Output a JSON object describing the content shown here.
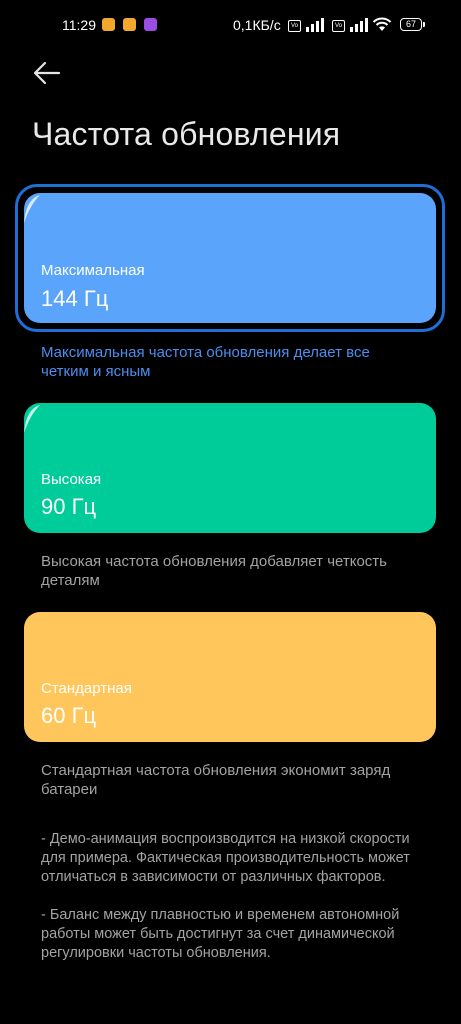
{
  "status_bar": {
    "time": "11:29",
    "net_speed": "0,1КБ/с",
    "volte_label": "Vo",
    "battery": "67"
  },
  "header": {
    "title": "Частота обновления"
  },
  "options": [
    {
      "label": "Максимальная",
      "value": "144 Гц",
      "description": "Максимальная частота обновления делает все четким и ясным",
      "selected": true,
      "color": "#5ba4fb"
    },
    {
      "label": "Высокая",
      "value": "90 Гц",
      "description": "Высокая частота обновления добавляет четкость деталям",
      "selected": false,
      "color": "#00cc99"
    },
    {
      "label": "Стандартная",
      "value": "60 Гц",
      "description": "Стандартная частота обновления экономит заряд батареи",
      "selected": false,
      "color": "#ffc65c"
    }
  ],
  "notes": [
    "- Демо-анимация воспроизводится на низкой скорости для примера. Фактическая производительность может отличаться в зависимости от различных факторов.",
    "- Баланс между плавностью и временем автономной работы может быть достигнут за счет динамической регулировки частоты обновления."
  ],
  "colors": {
    "accent": "#1d6fd6",
    "accent_text": "#4a8ef0",
    "background": "#000000"
  }
}
